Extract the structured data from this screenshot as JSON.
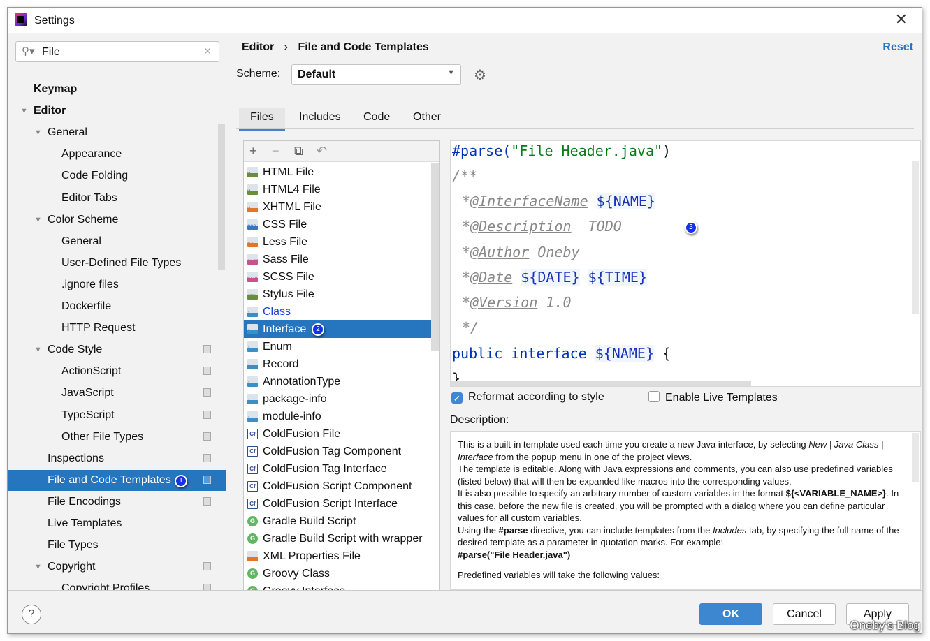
{
  "window": {
    "title": "Settings"
  },
  "search": {
    "value": "File"
  },
  "tree": [
    {
      "label": "Keymap",
      "level": 0,
      "bold": true
    },
    {
      "label": "Editor",
      "level": 0,
      "bold": true,
      "expanded": true
    },
    {
      "label": "General",
      "level": 1,
      "expanded": true
    },
    {
      "label": "Appearance",
      "level": 2
    },
    {
      "label": "Code Folding",
      "level": 2
    },
    {
      "label": "Editor Tabs",
      "level": 2
    },
    {
      "label": "Color Scheme",
      "level": 1,
      "expanded": true
    },
    {
      "label": "General",
      "level": 2
    },
    {
      "label": "User-Defined File Types",
      "level": 2
    },
    {
      "label": ".ignore files",
      "level": 2
    },
    {
      "label": "Dockerfile",
      "level": 2
    },
    {
      "label": "HTTP Request",
      "level": 2
    },
    {
      "label": "Code Style",
      "level": 1,
      "expanded": true,
      "copy": true
    },
    {
      "label": "ActionScript",
      "level": 2,
      "copy": true
    },
    {
      "label": "JavaScript",
      "level": 2,
      "copy": true
    },
    {
      "label": "TypeScript",
      "level": 2,
      "copy": true
    },
    {
      "label": "Other File Types",
      "level": 2,
      "copy": true
    },
    {
      "label": "Inspections",
      "level": 1,
      "copy": true
    },
    {
      "label": "File and Code Templates",
      "level": 1,
      "copy": true,
      "selected": true,
      "badge": "1"
    },
    {
      "label": "File Encodings",
      "level": 1,
      "copy": true
    },
    {
      "label": "Live Templates",
      "level": 1
    },
    {
      "label": "File Types",
      "level": 1
    },
    {
      "label": "Copyright",
      "level": 1,
      "expanded": true,
      "copy": true
    },
    {
      "label": "Copyright Profiles",
      "level": 2,
      "copy": true
    }
  ],
  "breadcrumb": {
    "parent": "Editor",
    "separator": "›",
    "current": "File and Code Templates"
  },
  "reset_label": "Reset",
  "scheme": {
    "label": "Scheme:",
    "value": "Default"
  },
  "tabs": [
    "Files",
    "Includes",
    "Code",
    "Other"
  ],
  "active_tab": "Files",
  "file_toolbar": {
    "add": "+",
    "remove": "−",
    "copy": "⧉",
    "reset": "↶"
  },
  "files": [
    {
      "label": "HTML File",
      "icon": "H",
      "color": "#6a8d3a"
    },
    {
      "label": "HTML4 File",
      "icon": "H",
      "color": "#6a8d3a"
    },
    {
      "label": "XHTML File",
      "icon": "H",
      "color": "#e0762c"
    },
    {
      "label": "CSS File",
      "icon": "CSS",
      "color": "#3a72c4"
    },
    {
      "label": "Less File",
      "icon": "{L}",
      "color": "#e0762c"
    },
    {
      "label": "Sass File",
      "icon": "SASS",
      "color": "#c6538c"
    },
    {
      "label": "SCSS File",
      "icon": "SASS",
      "color": "#c6538c"
    },
    {
      "label": "Stylus File",
      "icon": "STYL",
      "color": "#6a8d3a"
    },
    {
      "label": "Class",
      "icon": "J",
      "color": "#3a8fc4",
      "link": true
    },
    {
      "label": "Interface",
      "icon": "J",
      "color": "#3a8fc4",
      "selected": true,
      "badge": "2"
    },
    {
      "label": "Enum",
      "icon": "J",
      "color": "#3a8fc4"
    },
    {
      "label": "Record",
      "icon": "J",
      "color": "#3a8fc4"
    },
    {
      "label": "AnnotationType",
      "icon": "J",
      "color": "#3a8fc4"
    },
    {
      "label": "package-info",
      "icon": "J",
      "color": "#3a8fc4"
    },
    {
      "label": "module-info",
      "icon": "J",
      "color": "#3a8fc4"
    },
    {
      "label": "ColdFusion File",
      "icon": "Cf",
      "color": "#2d4c8a"
    },
    {
      "label": "ColdFusion Tag Component",
      "icon": "Cf",
      "color": "#2d4c8a"
    },
    {
      "label": "ColdFusion Tag Interface",
      "icon": "Cf",
      "color": "#2d4c8a"
    },
    {
      "label": "ColdFusion Script Component",
      "icon": "Cf",
      "color": "#2d4c8a"
    },
    {
      "label": "ColdFusion Script Interface",
      "icon": "Cf",
      "color": "#2d4c8a"
    },
    {
      "label": "Gradle Build Script",
      "icon": "G",
      "color": "#5fb85f"
    },
    {
      "label": "Gradle Build Script with wrapper",
      "icon": "G",
      "color": "#5fb85f"
    },
    {
      "label": "XML Properties File",
      "icon": "<>",
      "color": "#e0762c"
    },
    {
      "label": "Groovy Class",
      "icon": "G",
      "color": "#5fb85f"
    },
    {
      "label": "Groovy Interface",
      "icon": "G",
      "color": "#5fb85f"
    }
  ],
  "editor": {
    "line1": {
      "directive": "#parse(",
      "string": "\"File Header.java\"",
      "close": ")"
    },
    "comment_open": "/**",
    "tags": [
      {
        "star": "*",
        "tag": "@InterfaceName",
        "rest": " ",
        "var": "${NAME}"
      },
      {
        "star": "*",
        "tag": "@Description",
        "rest": "  TODO",
        "var": ""
      },
      {
        "star": "*",
        "tag": "@Author",
        "rest": " Oneby",
        "var": ""
      },
      {
        "star": "*",
        "tag": "@Date",
        "rest": " ",
        "var": "${DATE}",
        "var2": "${TIME}"
      },
      {
        "star": "*",
        "tag": "@Version",
        "rest": " 1.0",
        "var": ""
      }
    ],
    "comment_close": "*/",
    "decl": {
      "kw": "public interface ",
      "var": "${NAME}",
      "brace": " {"
    },
    "end": "}",
    "badge": "3"
  },
  "options": {
    "reformat": {
      "label": "Reformat according to style",
      "checked": true
    },
    "live_templates": {
      "label": "Enable Live Templates",
      "checked": false
    }
  },
  "description": {
    "label": "Description:",
    "p1a": "This is a built-in template used each time you create a new Java interface, by selecting ",
    "p1b": "New | Java Class | Interface",
    "p1c": " from the popup menu in one of the project views.",
    "p2": "The template is editable. Along with Java expressions and comments, you can also use predefined variables (listed below) that will then be expanded like macros into the corresponding values.",
    "p3a": "It is also possible to specify an arbitrary number of custom variables in the format ",
    "p3b": "${<VARIABLE_NAME>}",
    "p3c": ". In this case, before the new file is created, you will be prompted with a dialog where you can define particular values for all custom variables.",
    "p4a": "Using the ",
    "p4b": "#parse",
    "p4c": " directive, you can include templates from the ",
    "p4d": "Includes",
    "p4e": " tab, by specifying the full name of the desired template as a parameter in quotation marks. For example:",
    "p5": "#parse(\"File Header.java\")",
    "p6": "Predefined variables will take the following values:"
  },
  "footer": {
    "help": "?",
    "ok": "OK",
    "cancel": "Cancel",
    "apply": "Apply"
  },
  "watermark": "Oneby's Blog",
  "colors": {
    "accent": "#2675bf",
    "selection": "#2675bf",
    "ok_button": "#3d86d0",
    "badge": "#1731e6"
  }
}
